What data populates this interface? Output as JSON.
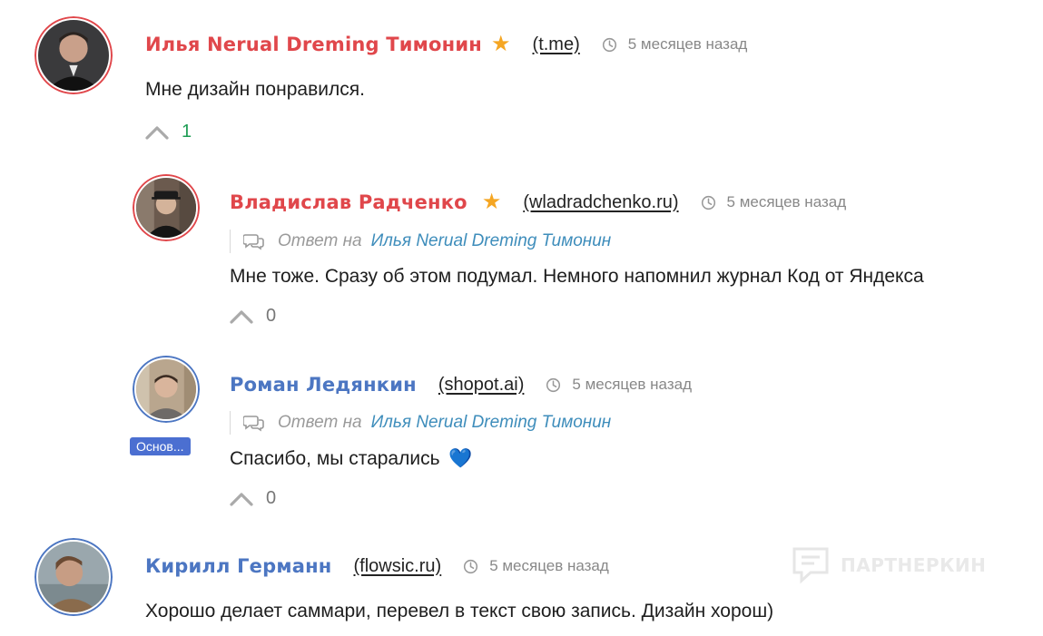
{
  "comments": [
    {
      "author": "Илья Nerual Dreming Тимонин",
      "author_color": "#e0474b",
      "starred": true,
      "site": "(t.me)",
      "time": "5 месяцев назад",
      "text": "Мне дизайн понравился.",
      "votes": "1"
    },
    {
      "author": "Владислав Радченко",
      "author_color": "#e0474b",
      "starred": true,
      "site": "(wladradchenko.ru)",
      "time": "5 месяцев назад",
      "reply_label": "Ответ на",
      "reply_to": "Илья Nerual Dreming Тимонин",
      "text": "Мне тоже. Сразу об этом подумал. Немного напомнил журнал Код от Яндекса",
      "votes": "0"
    },
    {
      "author": "Роман Ледянкин",
      "author_color": "#4c76c2",
      "starred": false,
      "site": "(shopot.ai)",
      "time": "5 месяцев назад",
      "badge": "Основ...",
      "reply_label": "Ответ на",
      "reply_to": "Илья Nerual Dreming Тимонин",
      "text": "Спасибо, мы старались",
      "emoji": "💙",
      "votes": "0"
    },
    {
      "author": "Кирилл Германн",
      "author_color": "#4c76c2",
      "starred": false,
      "site": "(flowsic.ru)",
      "time": "5 месяцев назад",
      "text": "Хорошо делает саммари, перевел в текст свою запись. Дизайн хорош)"
    }
  ],
  "watermark": "ПАРТНЕРКИН",
  "icons": {
    "star": "star-icon",
    "clock": "clock-icon",
    "reply": "chat-bubbles-icon",
    "upvote": "chevron-up-icon"
  }
}
